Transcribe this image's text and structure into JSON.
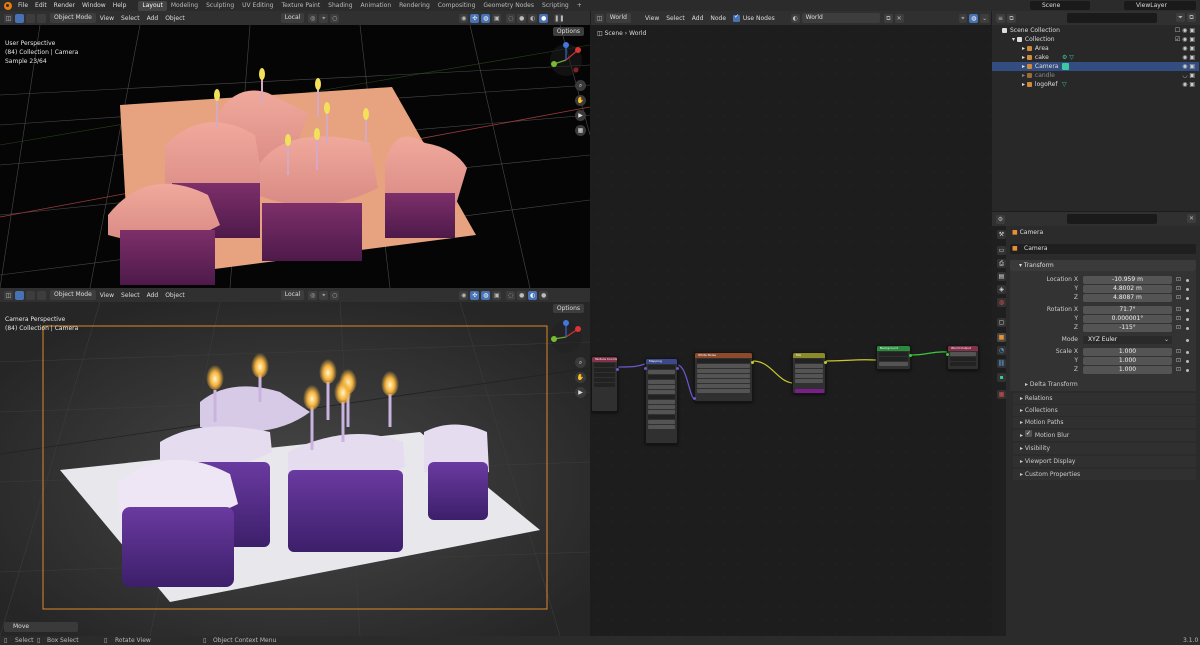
{
  "topbar": {
    "menus": [
      "File",
      "Edit",
      "Render",
      "Window",
      "Help"
    ],
    "workspaces": [
      {
        "label": "Layout",
        "active": true
      },
      {
        "label": "Modeling"
      },
      {
        "label": "Sculpting"
      },
      {
        "label": "UV Editing"
      },
      {
        "label": "Texture Paint"
      },
      {
        "label": "Shading"
      },
      {
        "label": "Animation"
      },
      {
        "label": "Rendering"
      },
      {
        "label": "Compositing"
      },
      {
        "label": "Geometry Nodes"
      },
      {
        "label": "Scripting"
      }
    ],
    "add_tab": "+",
    "scene": "Scene",
    "view_layer": "ViewLayer"
  },
  "viewport_top": {
    "mode": "Object Mode",
    "menus": [
      "View",
      "Select",
      "Add",
      "Object"
    ],
    "transform": "Local",
    "info_lines": [
      "User Perspective",
      "(84) Collection | Camera",
      "Sample 23/64"
    ],
    "options": "Options"
  },
  "viewport_bottom": {
    "mode": "Object Mode",
    "menus": [
      "View",
      "Select",
      "Add",
      "Object"
    ],
    "transform": "Local",
    "info_lines": [
      "Camera Perspective",
      "(84) Collection | Camera"
    ],
    "options": "Options",
    "operator_panel": "Move"
  },
  "node_editor": {
    "type": "World",
    "menus": [
      "View",
      "Select",
      "Add",
      "Node"
    ],
    "use_nodes": "Use Nodes",
    "world_name": "World",
    "breadcrumb": [
      "Scene",
      "World"
    ],
    "nodes": [
      {
        "title": "Texture Coordinate",
        "color": "#83314a"
      },
      {
        "title": "Mapping",
        "color": "#3b4a8a"
      },
      {
        "title": "White Noise",
        "color": "#8a4a2b"
      },
      {
        "title": "Mix",
        "color": "#8a8a2b"
      },
      {
        "title": "Background",
        "color": "#2b8a3b"
      },
      {
        "title": "World Output",
        "color": "#83314a"
      }
    ]
  },
  "outliner": {
    "filter_placeholder": "",
    "scene_collection": "Scene Collection",
    "collection": "Collection",
    "items": [
      {
        "label": "Area",
        "icon_color": "#d08a3b"
      },
      {
        "label": "cake",
        "icon_color": "#d08a3b"
      },
      {
        "label": "Camera",
        "icon_color": "#d08a3b",
        "selected": true
      },
      {
        "label": "candle",
        "icon_color": "#d08a3b"
      },
      {
        "label": "logoRef",
        "icon_color": "#d08a3b"
      }
    ]
  },
  "properties": {
    "object_name": "Camera",
    "object_field": "Camera",
    "transform_header": "Transform",
    "location_label": "Location X",
    "location": [
      "-10.959 m",
      "4.8002 m",
      "4.8087 m"
    ],
    "rotation_label": "Rotation X",
    "rotation": [
      "71.7°",
      "0.000001°",
      "-115°"
    ],
    "axis_labels": [
      "Y",
      "Z"
    ],
    "mode_label": "Mode",
    "mode_value": "XYZ Euler",
    "scale_label": "Scale X",
    "scale": [
      "1.000",
      "1.000",
      "1.000"
    ],
    "delta_transform": "Delta Transform",
    "panels": [
      "Relations",
      "Collections",
      "Motion Paths",
      "Motion Blur",
      "Visibility",
      "Viewport Display",
      "Custom Properties"
    ]
  },
  "statusbar": {
    "select": "Select",
    "box_select": "Box Select",
    "rotate_view": "Rotate View",
    "context_menu": "Object Context Menu",
    "version": "3.1.0"
  }
}
